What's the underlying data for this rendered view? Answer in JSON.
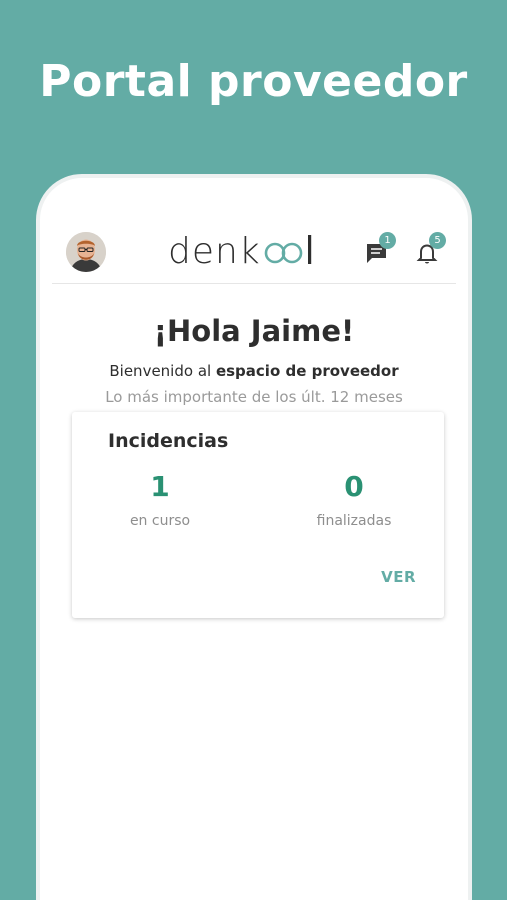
{
  "promo": {
    "title": "Portal proveedor"
  },
  "header": {
    "logo_text": "denkool",
    "chat_badge": "1",
    "notifications_badge": "5",
    "colors": {
      "accent": "#63aca5"
    }
  },
  "welcome": {
    "greeting": "¡Hola Jaime!",
    "intro_prefix": "Bienvenido al ",
    "intro_strong": "espacio de proveedor",
    "subtitle": "Lo más importante de los últ. 12 meses"
  },
  "incidencias": {
    "title": "Incidencias",
    "in_progress_value": "1",
    "in_progress_label": "en curso",
    "finished_value": "0",
    "finished_label": "finalizadas",
    "view_label": "VER",
    "value_color": "#2a9173"
  }
}
